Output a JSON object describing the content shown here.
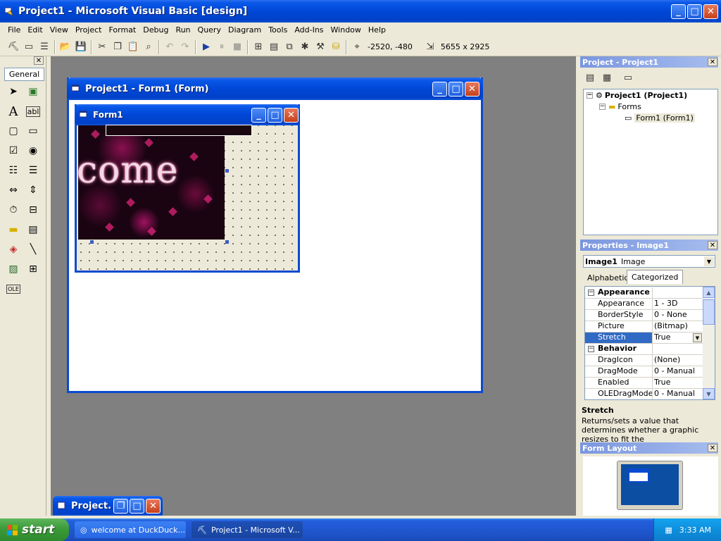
{
  "app": {
    "title": "Project1 - Microsoft Visual Basic [design]"
  },
  "menu": [
    "File",
    "Edit",
    "View",
    "Project",
    "Format",
    "Debug",
    "Run",
    "Query",
    "Diagram",
    "Tools",
    "Add-Ins",
    "Window",
    "Help"
  ],
  "toolbar": {
    "position_readout": "-2520, -480",
    "size_readout": "5655 x 2925"
  },
  "toolbox": {
    "tab_label": "General"
  },
  "form_window": {
    "title": "Project1 - Form1 (Form)"
  },
  "inner_form": {
    "title": "Form1",
    "image_text": "come"
  },
  "project_explorer": {
    "title": "Project - Project1",
    "tree": {
      "project": "Project1 (Project1)",
      "folder": "Forms",
      "form": "Form1 (Form1)"
    }
  },
  "properties": {
    "title": "Properties - Image1",
    "object_name": "Image1",
    "object_type": "Image",
    "tabs": [
      "Alphabetic",
      "Categorized"
    ],
    "rows": [
      {
        "name": "Appearance",
        "value": "",
        "category": true
      },
      {
        "name": "Appearance",
        "value": "1 - 3D"
      },
      {
        "name": "BorderStyle",
        "value": "0 - None"
      },
      {
        "name": "Picture",
        "value": "(Bitmap)"
      },
      {
        "name": "Stretch",
        "value": "True",
        "selected": true
      },
      {
        "name": "Behavior",
        "value": "",
        "category": true
      },
      {
        "name": "DragIcon",
        "value": "(None)"
      },
      {
        "name": "DragMode",
        "value": "0 - Manual"
      },
      {
        "name": "Enabled",
        "value": "True"
      },
      {
        "name": "OLEDragMode",
        "value": "0 - Manual"
      }
    ],
    "description_title": "Stretch",
    "description_text": "Returns/sets a value that determines whether a graphic resizes to fit the"
  },
  "form_layout": {
    "title": "Form Layout"
  },
  "minimized_window": {
    "title": "Project..."
  },
  "taskbar": {
    "start_label": "start",
    "tasks": [
      {
        "label": "welcome at DuckDuck...",
        "active": false
      },
      {
        "label": "Project1 - Microsoft V...",
        "active": true
      }
    ],
    "clock": "3:33 AM"
  },
  "colors": {
    "title_blue": "#0047d6",
    "selection": "#316ac5",
    "mdi_gray": "#808080",
    "start_green": "#3c9a3a"
  }
}
